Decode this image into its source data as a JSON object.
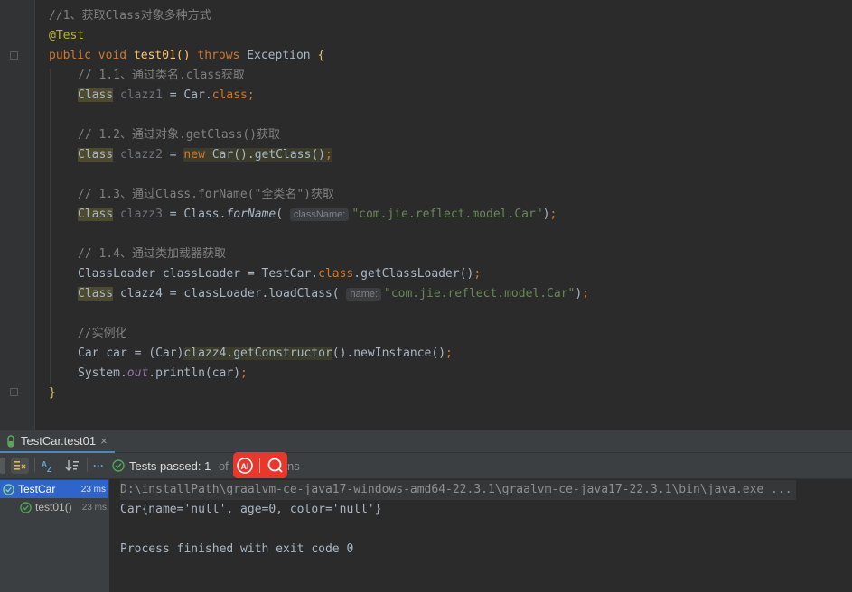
{
  "code": {
    "comment_1": "//1、获取Class对象多种方式",
    "annotation": "@Test",
    "kw_public": "public",
    "kw_void": "void",
    "method_name": "test01",
    "method_parens": "()",
    "kw_throws": "throws",
    "exception_type": "Exception",
    "open_brace": "{",
    "close_brace": "}",
    "c_1_1": "// 1.1、通过类名.class获取",
    "c_1_2": "// 1.2、通过对象.getClass()获取",
    "c_1_3": "// 1.3、通过Class.forName(\"全类名\")获取",
    "c_1_4": "// 1.4、通过类加载器获取",
    "c_inst": "//实例化",
    "type_class": "Class",
    "var_clazz1": "clazz1",
    "var_clazz2": "clazz2",
    "var_clazz3": "clazz3",
    "var_clazz4": "clazz4",
    "eq": " = ",
    "car": "Car",
    "dot": ".",
    "kw_class": "class",
    "semi": ";",
    "kw_new": "new",
    "get_class": "getClass",
    "paren_open": "(",
    "paren_close": ")",
    "parens": "()",
    "for_name": "forName",
    "hint_classname": "className:",
    "str_pkg": "\"com.jie.reflect.model.Car\"",
    "classloader_type": "ClassLoader",
    "var_classloader": "classLoader",
    "testcar": "TestCar",
    "get_classloader": "getClassLoader",
    "load_class": "loadClass",
    "hint_name": "name:",
    "var_car": "car",
    "get_constructor": "getConstructor",
    "new_instance": "newInstance",
    "system": "System",
    "out": "out",
    "println": "println"
  },
  "run_tab": {
    "label": "TestCar.test01",
    "close": "×"
  },
  "toolbar": {
    "status_text": "Tests passed: 1",
    "status_suffix": " of ",
    "status_tail": "ns",
    "more": "···"
  },
  "test_tree": [
    {
      "name": "TestCar",
      "time": "23 ms"
    },
    {
      "name": "test01()",
      "time": "23 ms"
    }
  ],
  "console": {
    "cmd": "D:\\installPath\\graalvm-ce-java17-windows-amd64-22.3.1\\graalvm-ce-java17-22.3.1\\bin\\java.exe ...",
    "output": "Car{name='null', age=0, color='null'}",
    "finished": "Process finished with exit code 0"
  },
  "ai_badge": {
    "label": "AI"
  },
  "colors": {
    "editor_bg": "#2b2b2b",
    "keyword": "#cc7832",
    "string": "#6a8759",
    "comment": "#808080",
    "method": "#ffc66d",
    "pass_green": "#4fa854",
    "selection": "#2f65ca",
    "badge_red": "#e8372d"
  }
}
